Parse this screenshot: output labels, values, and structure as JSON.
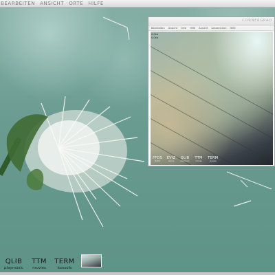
{
  "menubar": {
    "items": [
      "Bearbeiten",
      "Ansicht",
      "Orte",
      "Hilfe"
    ]
  },
  "window": {
    "title": "CORNERGRAD",
    "menu": [
      "Bearbeiten",
      "Ansicht",
      "Orte",
      "Hilfe",
      "Ansicht",
      "Lesezeichen",
      "Hilfe"
    ],
    "viewer_info": [
      "0.0kb",
      "0.0kb"
    ],
    "dock": [
      {
        "abbr": "FFDS",
        "name": "firefox"
      },
      {
        "abbr": "EVIZ",
        "name": "evince"
      },
      {
        "abbr": "QLIB",
        "name": "playmusic"
      },
      {
        "abbr": "TTM",
        "name": "movies"
      },
      {
        "abbr": "TERM",
        "name": "konsole"
      }
    ]
  },
  "dock": {
    "launchers": [
      {
        "abbr": "QLIB",
        "name": "playmusic"
      },
      {
        "abbr": "TTM",
        "name": "movies"
      },
      {
        "abbr": "TERM",
        "name": "konsole"
      }
    ]
  }
}
